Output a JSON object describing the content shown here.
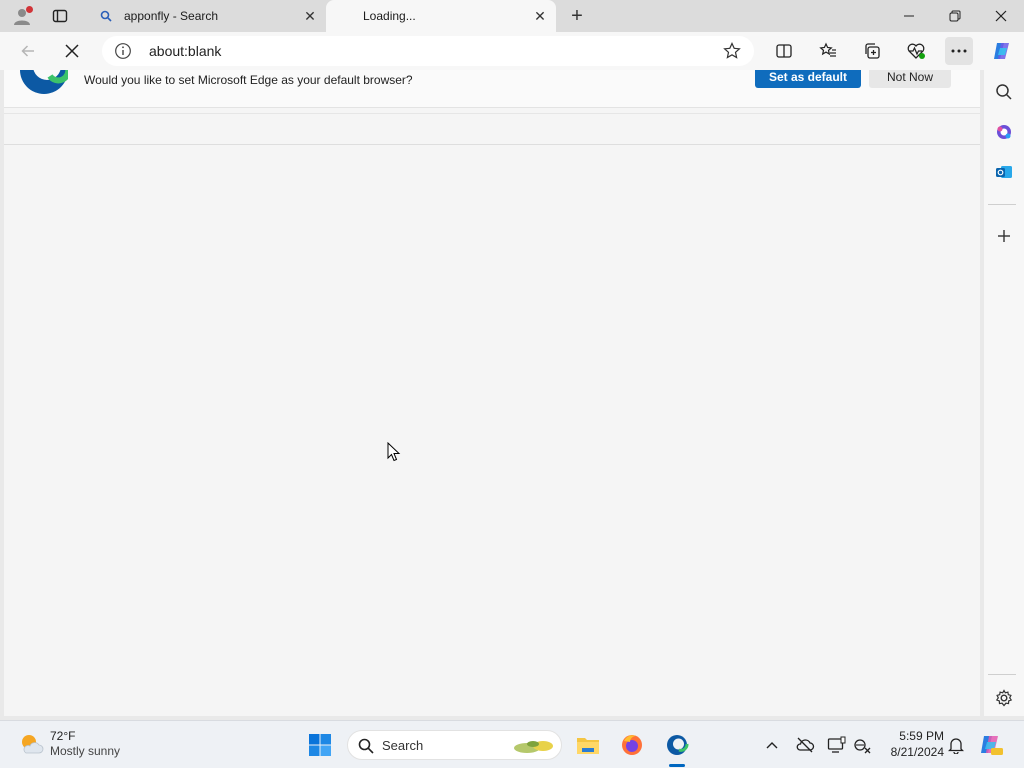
{
  "tabs": [
    {
      "title": "apponfly - Search",
      "favicon": "search-icon"
    },
    {
      "title": "Loading...",
      "favicon": "loading-icon"
    }
  ],
  "toolbar": {
    "url": "about:blank"
  },
  "infobar": {
    "message": "Would you like to set Microsoft Edge as your default browser?",
    "set_default_label": "Set as default",
    "not_now_label": "Not Now"
  },
  "taskbar": {
    "weather_temp": "72°F",
    "weather_condition": "Mostly sunny",
    "search_label": "Search",
    "time": "5:59 PM",
    "date": "8/21/2024"
  },
  "colors": {
    "accent": "#0f6cbd",
    "page_bg": "#f5f5f5",
    "titlebar_bg": "#dcdcdc"
  }
}
